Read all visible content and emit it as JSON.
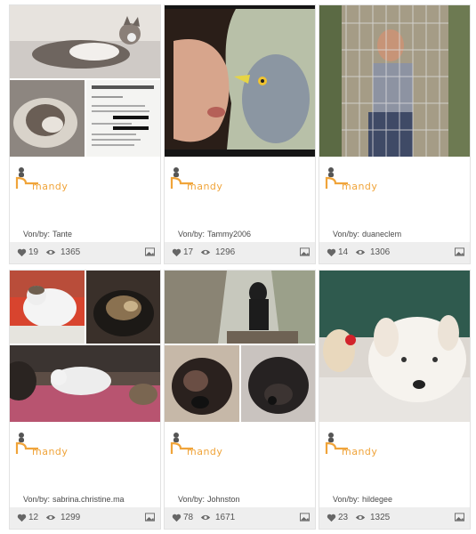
{
  "author_prefix": "Von/by:",
  "cards": [
    {
      "username": "mandy",
      "author": "Tante",
      "likes": "19",
      "views": "1365"
    },
    {
      "username": "mandy",
      "author": "Tammy2006",
      "likes": "17",
      "views": "1296"
    },
    {
      "username": "mandy",
      "author": "duaneclem",
      "likes": "14",
      "views": "1306"
    },
    {
      "username": "mandy",
      "author": "sabrina.christine.ma",
      "likes": "12",
      "views": "1299"
    },
    {
      "username": "mandy",
      "author": "Johnston",
      "likes": "78",
      "views": "1671"
    },
    {
      "username": "mandy",
      "author": "hildegee",
      "likes": "23",
      "views": "1325"
    }
  ],
  "colors": {
    "username": "#f0a43a",
    "stats_bg": "#eeeeee",
    "card_border": "#e2e2e2"
  },
  "icons": {
    "likes": "heart-icon",
    "views": "eye-icon",
    "gallery": "gallery-icon",
    "avatar": "mascot-logo"
  }
}
